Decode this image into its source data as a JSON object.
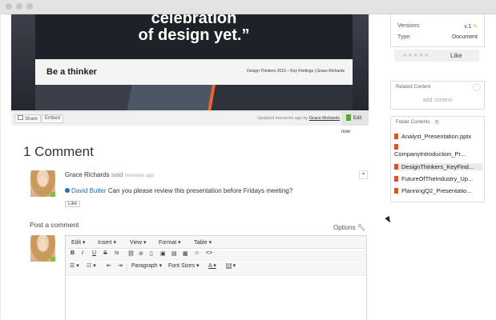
{
  "slide": {
    "quote_line1": "celebration",
    "quote_line2": "of design yet.”",
    "subtitle": "Be a thinker",
    "meta": "Design Thinkers 2015 – Key Findings  |  Grace Richards"
  },
  "slide_footer": {
    "share_label": "Share",
    "embed_label": "Embed",
    "updated_prefix": "Updated moments ago by",
    "updated_by": "Grace Richards",
    "edit_label": "Edit now"
  },
  "properties": {
    "versions_label": "Versions:",
    "versions_value": "v.1",
    "type_label": "Type:",
    "type_value": "Document"
  },
  "rating": {
    "stars": "★★★★★",
    "like_label": "Like"
  },
  "related": {
    "title": "Related Content",
    "add_label": "add content"
  },
  "folder": {
    "title": "Folder Contents",
    "count": "5",
    "files": [
      "Analyst_Presentation.pptx",
      "CompanyIntroduction_Pr...",
      "DesignThinkers_KeyFind...",
      "FutureOfTheIndustry_Up...",
      "PlanningQ2_Presentatio..."
    ],
    "selected_index": 2
  },
  "comments": {
    "heading": "1 Comment",
    "author": "Grace Richards",
    "said": "said",
    "when": "moments ago",
    "mention": "David Butler",
    "text": "Can you please review this presentation before Fridays meeting?",
    "like_label": "Like"
  },
  "post": {
    "heading": "Post a comment",
    "options_label": "Options"
  },
  "editor": {
    "menus": [
      "Edit",
      "Insert",
      "View",
      "Format",
      "Table"
    ],
    "paragraph_label": "Paragraph",
    "font_sizes_label": "Font Sizes"
  },
  "colors": {
    "accent_link": "#2b6cb0",
    "online": "#7cc142",
    "ppt_icon": "#d8542a"
  }
}
